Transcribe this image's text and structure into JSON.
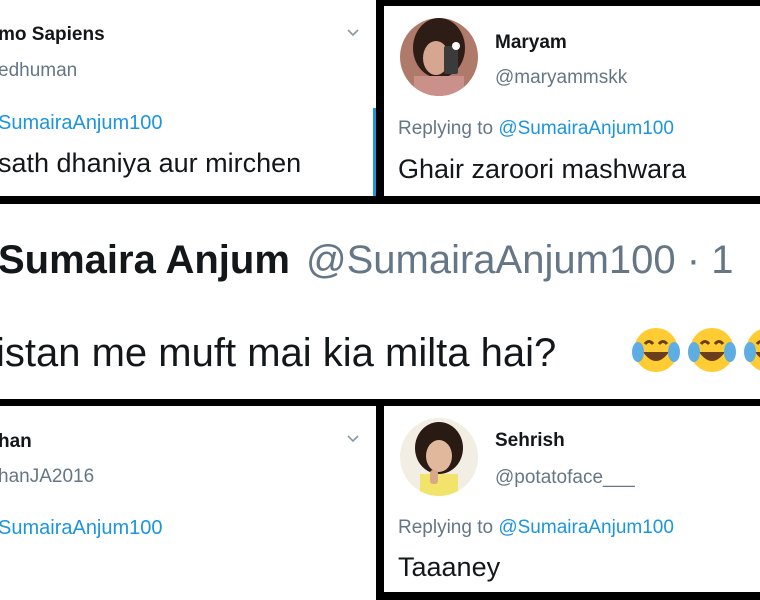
{
  "top_left": {
    "name": "mo Sapiens",
    "handle": "edhuman",
    "reply_to": "SumairaAnjum100",
    "text": "sath dhaniya aur mirchen",
    "icon": "chevron-down-icon"
  },
  "top_right": {
    "name": "Maryam",
    "handle": "@maryammskk",
    "replying_label": "Replying to",
    "reply_to": "@SumairaAnjum100",
    "text": "Ghair zaroori mashwara",
    "avatar": "avatar"
  },
  "main_tweet": {
    "name": "Sumaira Anjum",
    "handle": "@SumairaAnjum100 · 1",
    "text": "istan me muft mai kia milta hai?",
    "emoji": [
      "face-with-tears-of-joy-icon",
      "face-with-tears-of-joy-icon",
      "face-with-tears-of-joy-icon"
    ]
  },
  "bottom_left": {
    "name": "han",
    "handle": "hanJA2016",
    "reply_to": "SumairaAnjum100",
    "icon": "chevron-down-icon"
  },
  "bottom_right": {
    "name": "Sehrish",
    "handle": "@potatoface___",
    "replying_label": "Replying to",
    "reply_to": "@SumairaAnjum100",
    "text": "Taaaney",
    "avatar": "avatar"
  },
  "colors": {
    "link": "#1b95e0",
    "secondary_text": "#657786",
    "primary_text": "#14171a",
    "divider": "#000000"
  }
}
